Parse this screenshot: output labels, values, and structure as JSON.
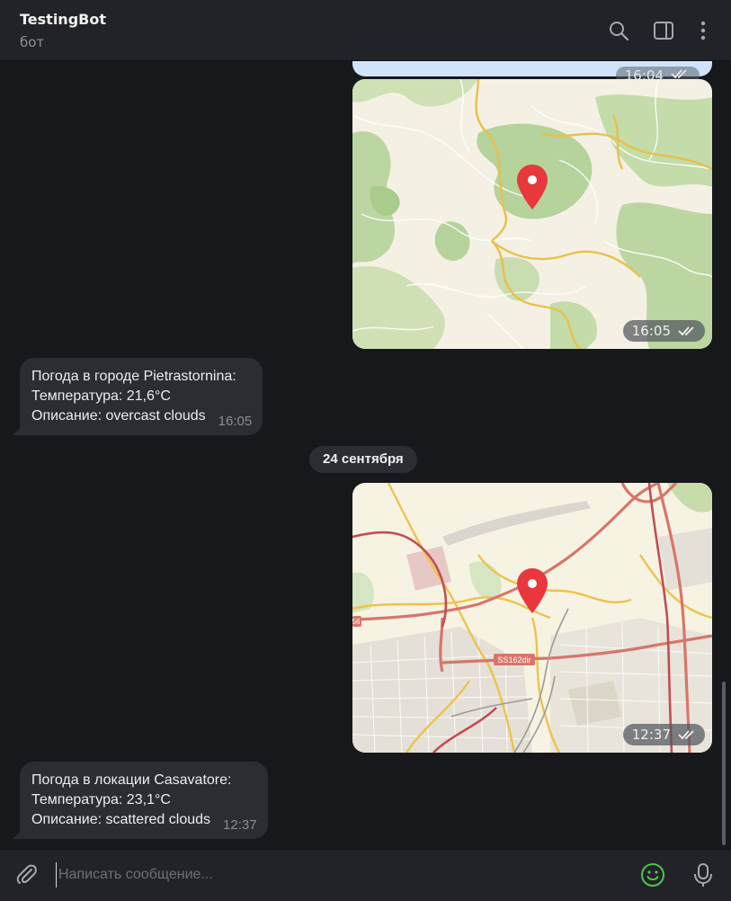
{
  "header": {
    "title": "TestingBot",
    "subtitle": "бот",
    "icons": [
      "search-icon",
      "sidebar-toggle-icon",
      "more-vertical-icon"
    ]
  },
  "messages": {
    "prev_time": "16:04",
    "map1_time": "16:05",
    "weather1": {
      "line1": "Погода в городе Pietrastornina:",
      "line2": "Температура: 21,6°C",
      "line3": "Описание: overcast clouds",
      "time": "16:05"
    },
    "date_separator": "24 сентября",
    "map2_time": "12:37",
    "map2_road_label": "SS162dir",
    "map2_edge_label": "56",
    "weather2": {
      "line1": "Погода в локации Casavatore:",
      "line2": "Температура: 23,1°C",
      "line3": "Описание: scattered clouds",
      "time": "12:37"
    }
  },
  "composer": {
    "placeholder": "Написать сообщение...",
    "value": ""
  },
  "colors": {
    "accent_emoji": "#4ec44e",
    "pin": "#e8383d",
    "bubble_in": "#2b2d33",
    "bubble_out_prev": "#cfe4fa"
  }
}
